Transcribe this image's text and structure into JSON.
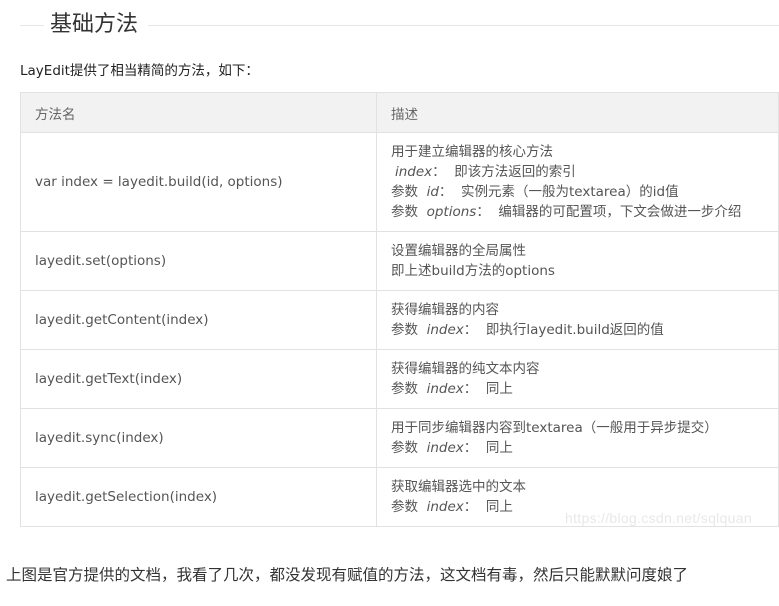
{
  "section": {
    "title": "基础方法"
  },
  "intro": "LayEdit提供了相当精简的方法，如下：",
  "table": {
    "headers": [
      "方法名",
      "描述"
    ],
    "rows": [
      {
        "method": "var index = layedit.build(id, options)",
        "desc": [
          {
            "text": "用于建立编辑器的核心方法"
          },
          {
            "param": "index",
            "text": "：  即该方法返回的索引"
          },
          {
            "prefix": "参数  ",
            "param": "id",
            "text": "：  实例元素（一般为textarea）的id值"
          },
          {
            "prefix": "参数  ",
            "param": "options",
            "text": "：  编辑器的可配置项，下文会做进一步介绍"
          }
        ]
      },
      {
        "method": "layedit.set(options)",
        "desc": [
          {
            "text": "设置编辑器的全局属性"
          },
          {
            "text": "即上述build方法的options"
          }
        ]
      },
      {
        "method": "layedit.getContent(index)",
        "desc": [
          {
            "text": "获得编辑器的内容"
          },
          {
            "prefix": "参数  ",
            "param": "index",
            "text": "：  即执行layedit.build返回的值"
          }
        ]
      },
      {
        "method": "layedit.getText(index)",
        "desc": [
          {
            "text": "获得编辑器的纯文本内容"
          },
          {
            "prefix": "参数  ",
            "param": "index",
            "text": "：  同上"
          }
        ]
      },
      {
        "method": "layedit.sync(index)",
        "desc": [
          {
            "text": "用于同步编辑器内容到textarea（一般用于异步提交）"
          },
          {
            "prefix": "参数  ",
            "param": "index",
            "text": "：  同上"
          }
        ]
      },
      {
        "method": "layedit.getSelection(index)",
        "desc": [
          {
            "text": "获取编辑器选中的文本"
          },
          {
            "prefix": "参数  ",
            "param": "index",
            "text": "：  同上"
          }
        ]
      }
    ]
  },
  "watermark": "https://blog.csdn.net/sqlquan",
  "footer": "上图是官方提供的文档，我看了几次，都没发现有赋值的方法，这文档有毒，然后只能默默问度娘了"
}
